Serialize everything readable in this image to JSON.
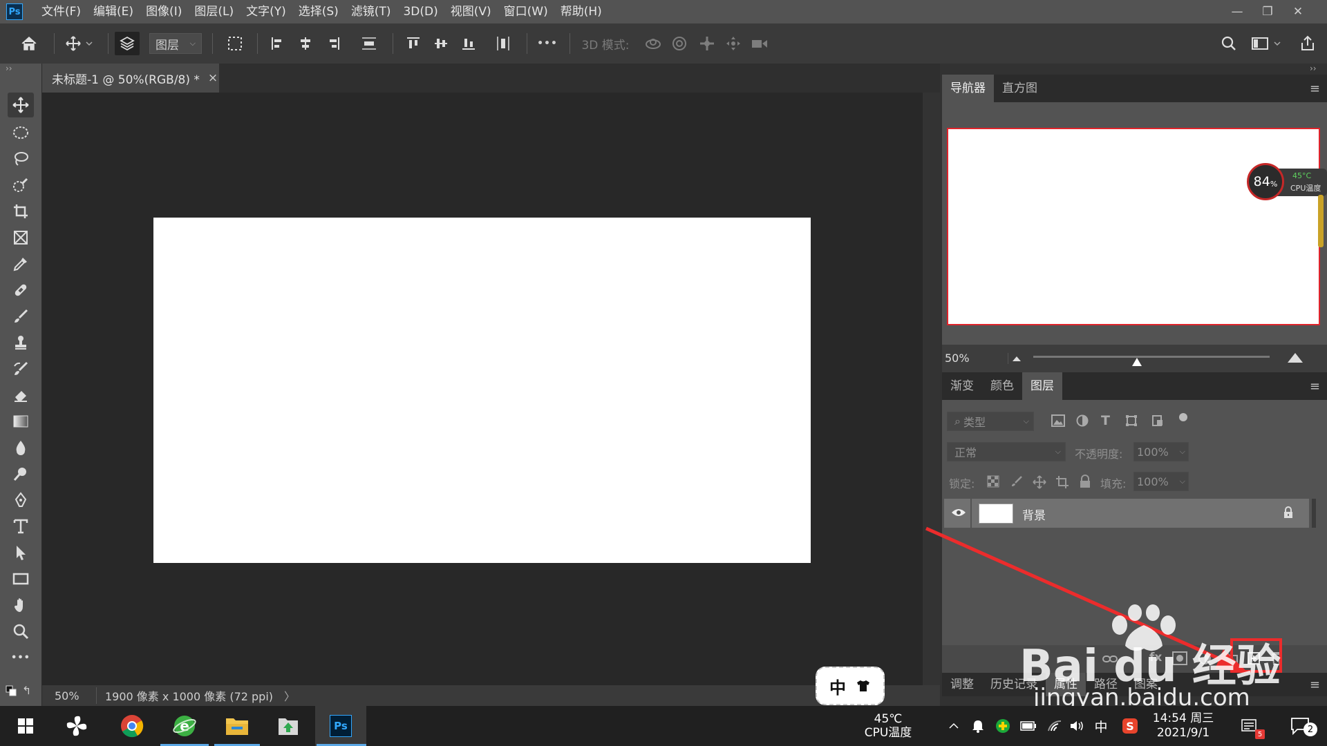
{
  "app": {
    "logo": "Ps",
    "menus": [
      "文件(F)",
      "编辑(E)",
      "图像(I)",
      "图层(L)",
      "文字(Y)",
      "选择(S)",
      "滤镜(T)",
      "3D(D)",
      "视图(V)",
      "窗口(W)",
      "帮助(H)"
    ],
    "window_buttons": {
      "minimize": "—",
      "restore": "❐",
      "close": "✕"
    }
  },
  "options_bar": {
    "layer_select_label": "图层",
    "mode_3d_label": "3D 模式:",
    "more_label": "•••"
  },
  "document": {
    "tab_title": "未标题-1 @ 50%(RGB/8) *",
    "tab_close": "×",
    "status_zoom": "50%",
    "status_info": "1900 像素 x 1000 像素 (72 ppi)",
    "status_arrow": "〉"
  },
  "navigator": {
    "tabs": [
      "导航器",
      "直方图"
    ],
    "active_tab": "导航器",
    "zoom": "50%",
    "widget": {
      "percent": "84",
      "percent_sign": "%",
      "temp": "45°C",
      "label": "CPU温度"
    }
  },
  "layers_panel": {
    "tabs": [
      "渐变",
      "颜色",
      "图层"
    ],
    "active_tab": "图层",
    "filter_placeholder": "类型",
    "blend_mode": "正常",
    "opacity_label": "不透明度:",
    "opacity_value": "100%",
    "lock_label": "锁定:",
    "fill_label": "填充:",
    "fill_value": "100%",
    "layers": [
      {
        "name": "背景",
        "visible": true,
        "locked": true
      }
    ]
  },
  "bottom_panel": {
    "tabs": [
      "调整",
      "历史记录",
      "属性",
      "路径",
      "图案"
    ],
    "active_tab": "属性"
  },
  "ime_popup": {
    "label": "中"
  },
  "watermark": {
    "brand": "Bai  du 经验",
    "url": "jingyan.baidu.com"
  },
  "taskbar": {
    "cpu_temp": "45℃",
    "cpu_label": "CPU温度",
    "ime": "中",
    "time": "14:54 周三",
    "date": "2021/9/1",
    "notification_badge": "5",
    "action_center_count": "2"
  },
  "colors": {
    "accent_red": "#e0242b",
    "ps_blue": "#31a8ff",
    "panel_bg": "#535353"
  }
}
